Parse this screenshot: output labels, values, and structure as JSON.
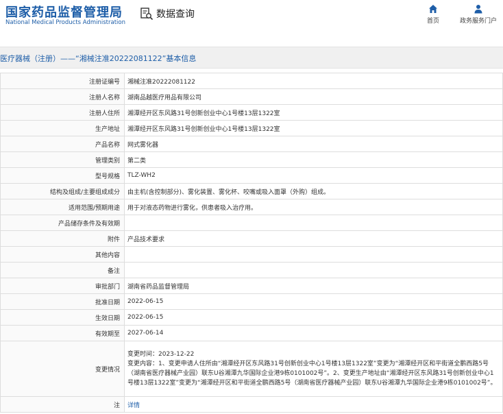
{
  "header": {
    "org_cn": "国家药品监督管理局",
    "org_en": "National Medical Products Administration",
    "query_label": "数据查询",
    "nav_home": "首页",
    "nav_portal": "政务服务门户"
  },
  "title": "医疗器械（注册）——“湘械注准20222081122”基本信息",
  "rows": [
    {
      "key": "注册证编号",
      "value": "湘械注准20222081122"
    },
    {
      "key": "注册人名称",
      "value": "湖南品越医疗用品有限公司"
    },
    {
      "key": "注册人住所",
      "value": "湘潭经开区东风路31号创新创业中心1号楼13层1322室"
    },
    {
      "key": "生产地址",
      "value": "湘潭经开区东风路31号创新创业中心1号楼13层1322室"
    },
    {
      "key": "产品名称",
      "value": "网式雾化器"
    },
    {
      "key": "管理类别",
      "value": "第二类"
    },
    {
      "key": "型号规格",
      "value": "TLZ-WH2"
    },
    {
      "key": "结构及组成/主要组成成分",
      "value": "由主机(含控制部分)、雾化装置、雾化杯、咬嘴或吸入面罩（外购）组成。"
    },
    {
      "key": "适用范围/预期用途",
      "value": "用于对液态药物进行雾化，供患者吸入治疗用。"
    },
    {
      "key": "产品储存条件及有效期",
      "value": ""
    },
    {
      "key": "附件",
      "value": "产品技术要求"
    },
    {
      "key": "其他内容",
      "value": ""
    },
    {
      "key": "备注",
      "value": ""
    },
    {
      "key": "审批部门",
      "value": "湖南省药品监督管理局"
    },
    {
      "key": "批准日期",
      "value": "2022-06-15"
    },
    {
      "key": "生效日期",
      "value": "2022-06-15"
    },
    {
      "key": "有效期至",
      "value": "2027-06-14"
    }
  ],
  "change": {
    "key": "变更情况",
    "time": "变更时间：2023-12-22",
    "content": "变更内容：1、变更申请人住所由“湘潭经开区东风路31号创新创业中心1号楼13层1322室”变更为“湘潭经开区和平街道全鹏西路5号（湖南省医疗器械产业园）联东U谷湘潭九华国际企业港9栋0101002号”。2、变更生产地址由“湘潭经开区东风路31号创新创业中心1号楼13层1322室”变更为“湘潭经开区和平街道全鹏西路5号（湖南省医疗器械产业园）联东U谷湘潭九华国际企业港9栋0101002号”。"
  },
  "note": {
    "key": "注",
    "value": "详情"
  }
}
